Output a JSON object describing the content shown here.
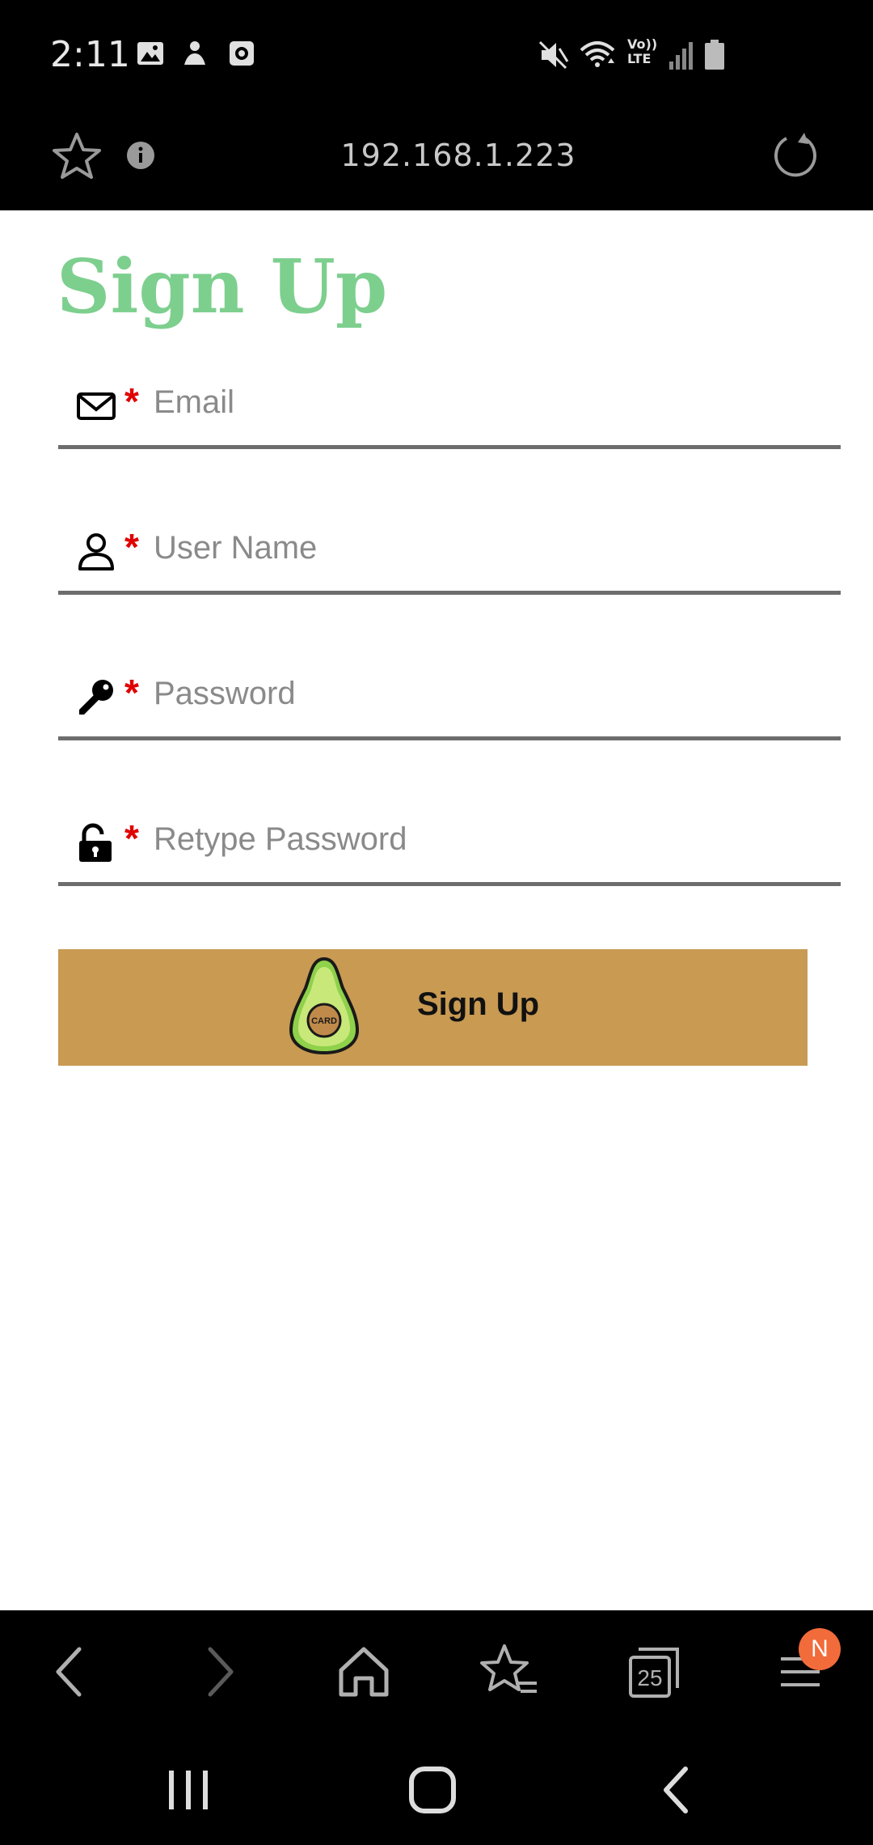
{
  "status_bar": {
    "time": "2:11",
    "left_icons": [
      "image-icon",
      "hand-icon",
      "clock-icon"
    ],
    "right_icons": [
      "mute-icon",
      "wifi-icon",
      "volte-icon",
      "signal-icon",
      "battery-icon"
    ],
    "volte_label_top": "Vo))",
    "volte_label_bottom": "LTE"
  },
  "browser": {
    "url": "192.168.1.223",
    "icons": [
      "star-icon",
      "info-icon",
      "reload-icon"
    ]
  },
  "page": {
    "title": "Sign Up",
    "required_mark": "*",
    "fields": [
      {
        "icon": "envelope-icon",
        "placeholder": "Email",
        "value": ""
      },
      {
        "icon": "user-icon",
        "placeholder": "User Name",
        "value": ""
      },
      {
        "icon": "key-icon",
        "placeholder": "Password",
        "value": ""
      },
      {
        "icon": "unlock-icon",
        "placeholder": "Retype Password",
        "value": ""
      }
    ],
    "button": {
      "label": "Sign Up",
      "logo_text": "CARD"
    }
  },
  "bottom_bar": {
    "items": [
      "back-icon",
      "forward-icon",
      "home-icon",
      "bookmarks-icon",
      "tabs-icon",
      "menu-icon"
    ],
    "tabs_count": "25",
    "menu_badge": "N"
  },
  "colors": {
    "title": "#7dcf8e",
    "button": "#c89a52",
    "required": "#e00000",
    "badge": "#f26b3a"
  }
}
